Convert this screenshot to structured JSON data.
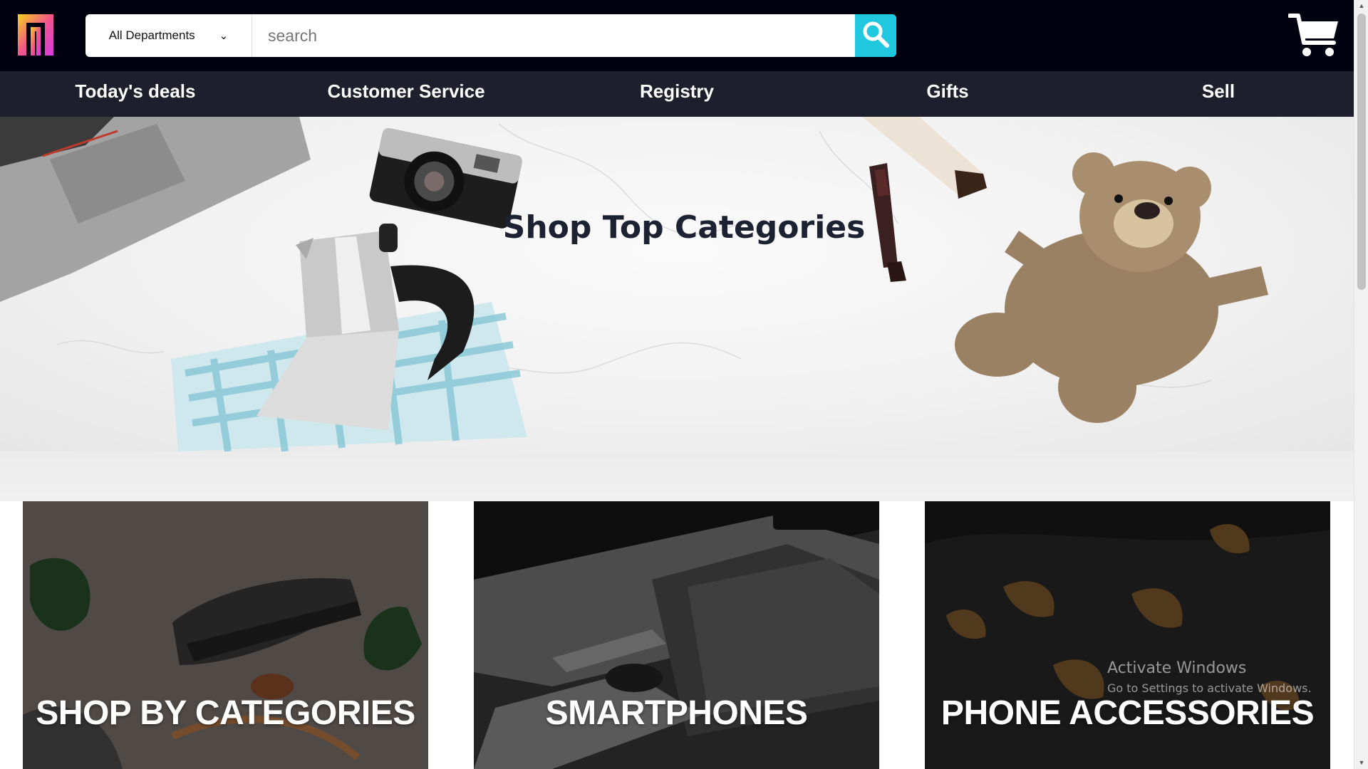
{
  "header": {
    "logo_icon": "brand-logo-icon",
    "department_select": {
      "selected": "All Departments",
      "options": [
        "All Departments"
      ]
    },
    "search": {
      "placeholder": "search",
      "value": ""
    },
    "search_icon": "magnifier-icon",
    "cart_icon": "shopping-cart-icon"
  },
  "nav": {
    "items": [
      "Today's deals",
      "Customer Service",
      "Registry",
      "Gifts",
      "Sell"
    ]
  },
  "hero": {
    "title": "Shop Top Categories"
  },
  "categories": {
    "cards": [
      {
        "label": "SHOP BY CATEGORIES"
      },
      {
        "label": "SMARTPHONES"
      },
      {
        "label": "PHONE ACCESSORIES"
      }
    ]
  },
  "watermark": {
    "line1": "Activate Windows",
    "line2": "Go to Settings to activate Windows."
  },
  "colors": {
    "topbar": "#02010f",
    "navbar": "#1e1e2c",
    "search_button": "#1fc7df",
    "hero_title": "#1d2233"
  }
}
